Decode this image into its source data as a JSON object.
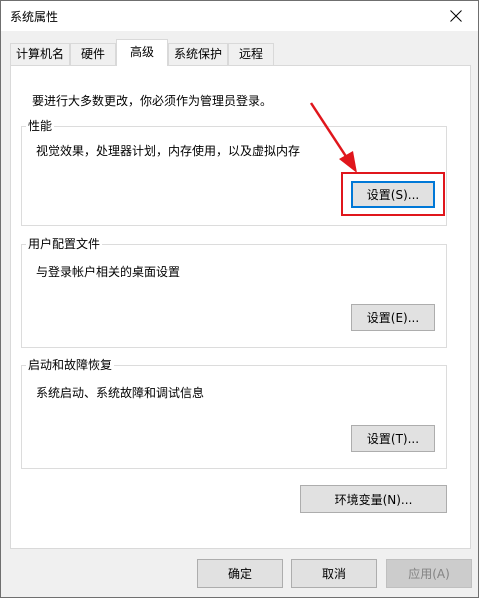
{
  "window": {
    "title": "系统属性"
  },
  "tabs": [
    {
      "label": "计算机名"
    },
    {
      "label": "硬件"
    },
    {
      "label": "高级"
    },
    {
      "label": "系统保护"
    },
    {
      "label": "远程"
    }
  ],
  "advanced": {
    "admin_note": "要进行大多数更改，你必须作为管理员登录。",
    "performance": {
      "title": "性能",
      "description": "视觉效果，处理器计划，内存使用，以及虚拟内存",
      "settings_button": "设置(S)..."
    },
    "user_profiles": {
      "title": "用户配置文件",
      "description": "与登录帐户相关的桌面设置",
      "settings_button": "设置(E)..."
    },
    "startup_recovery": {
      "title": "启动和故障恢复",
      "description": "系统启动、系统故障和调试信息",
      "settings_button": "设置(T)..."
    },
    "env_vars_button": "环境变量(N)..."
  },
  "footer": {
    "ok": "确定",
    "cancel": "取消",
    "apply": "应用(A)"
  },
  "colors": {
    "annotation_red": "#e0161c",
    "focus_blue": "#0078d7"
  }
}
